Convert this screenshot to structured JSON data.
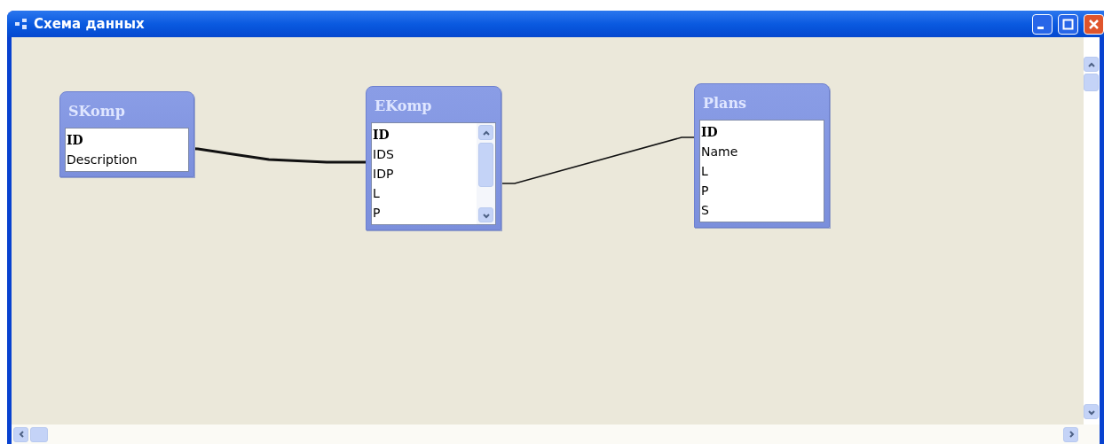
{
  "window": {
    "title": "Схема данных"
  },
  "tables": [
    {
      "name": "SKomp",
      "scrollbar": false,
      "fields": [
        {
          "name": "ID",
          "key": true
        },
        {
          "name": "Description",
          "key": false
        }
      ]
    },
    {
      "name": "EKomp",
      "scrollbar": true,
      "fields": [
        {
          "name": "ID",
          "key": true
        },
        {
          "name": "IDS",
          "key": false
        },
        {
          "name": "IDP",
          "key": false
        },
        {
          "name": "L",
          "key": false
        },
        {
          "name": "P",
          "key": false
        }
      ]
    },
    {
      "name": "Plans",
      "scrollbar": false,
      "fields": [
        {
          "name": "ID",
          "key": true
        },
        {
          "name": "Name",
          "key": false
        },
        {
          "name": "L",
          "key": false
        },
        {
          "name": "P",
          "key": false
        },
        {
          "name": "S",
          "key": false
        }
      ]
    }
  ]
}
